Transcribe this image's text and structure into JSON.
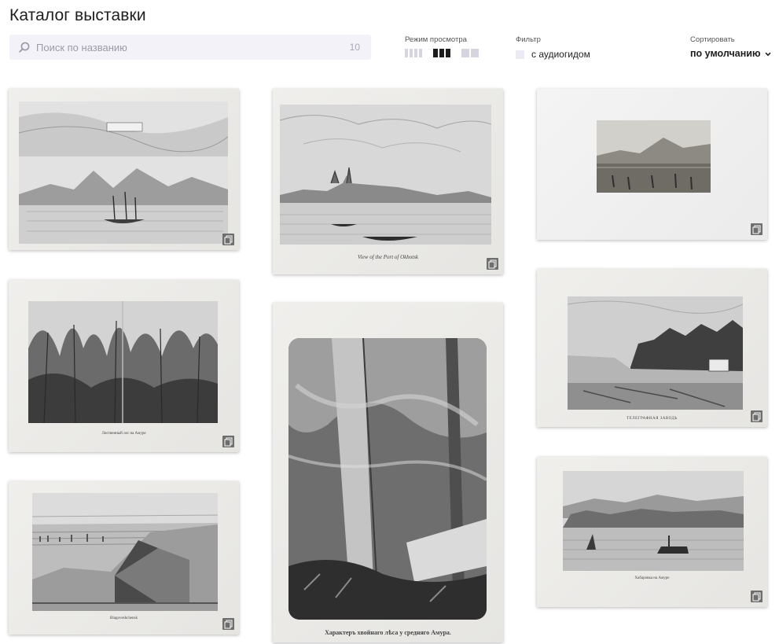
{
  "page": {
    "title": "Каталог выставки"
  },
  "search": {
    "placeholder": "Поиск по названию",
    "count": "10",
    "icon": "search-icon"
  },
  "controls": {
    "view_mode_label": "Режим просмотра",
    "view_modes": [
      "four-columns",
      "three-columns",
      "two-columns"
    ],
    "view_mode_selected": "three-columns",
    "filter_label": "Фильтр",
    "filter_option": "с аудиогидом",
    "filter_checked": false,
    "sort_label": "Сортировать",
    "sort_value": "по умолчанию"
  },
  "cards": [
    {
      "id": "card-1",
      "caption": ""
    },
    {
      "id": "card-2",
      "caption": "View of the Port of Okhotsk"
    },
    {
      "id": "card-3",
      "caption": ""
    },
    {
      "id": "card-4",
      "caption": "Лиственный лес на Амуре"
    },
    {
      "id": "card-5",
      "caption": "Характеръ хвойнаго лѣса у средняго Амура."
    },
    {
      "id": "card-6",
      "caption": "ТЕЛЕГРАФНАЯ ЗАВОДЬ"
    },
    {
      "id": "card-7",
      "caption": "Blagoveshchensk"
    },
    {
      "id": "card-8",
      "caption": "Хабаровка на Амуре"
    }
  ],
  "colors": {
    "search_bg": "#f3f2f8",
    "active_view": "#1c1c1c",
    "inactive_view": "#d6d5df",
    "expand_icon_bg": "#6e6e6e"
  }
}
